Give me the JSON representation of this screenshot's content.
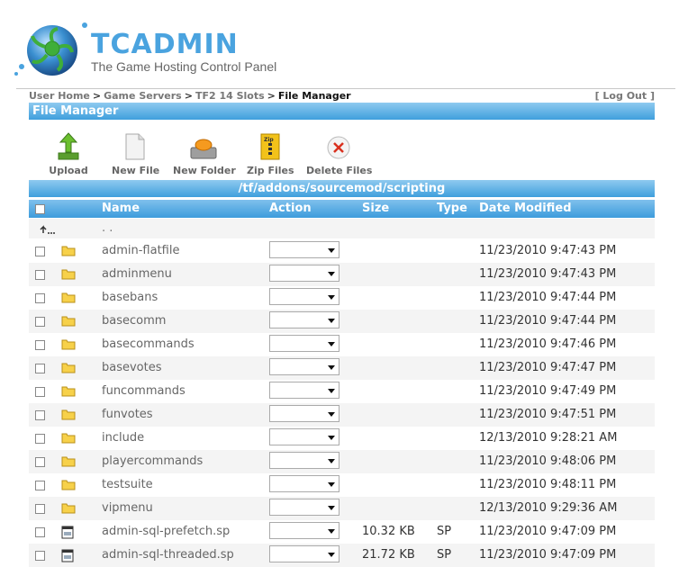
{
  "brand": {
    "name": "TCADMIN",
    "tagline": "The Game Hosting Control Panel"
  },
  "breadcrumb": [
    {
      "label": "User Home",
      "current": false
    },
    {
      "label": "Game Servers",
      "current": false
    },
    {
      "label": "TF2 14 Slots",
      "current": false
    },
    {
      "label": "File Manager",
      "current": true
    }
  ],
  "logout": "[ Log Out ]",
  "page_title": "File Manager",
  "toolbar": [
    {
      "label": "Upload",
      "icon": "upload-icon"
    },
    {
      "label": "New File",
      "icon": "new-file-icon"
    },
    {
      "label": "New Folder",
      "icon": "new-folder-icon"
    },
    {
      "label": "Zip Files",
      "icon": "zip-icon"
    },
    {
      "label": "Delete Files",
      "icon": "delete-icon"
    }
  ],
  "current_path": "/tf/addons/sourcemod/scripting",
  "columns": {
    "name": "Name",
    "action": "Action",
    "size": "Size",
    "type": "Type",
    "date": "Date Modified"
  },
  "parent_dir": ". .",
  "files": [
    {
      "name": "admin-flatfile",
      "kind": "folder",
      "size": "",
      "type": "",
      "date": "11/23/2010 9:47:43 PM"
    },
    {
      "name": "adminmenu",
      "kind": "folder",
      "size": "",
      "type": "",
      "date": "11/23/2010 9:47:43 PM"
    },
    {
      "name": "basebans",
      "kind": "folder",
      "size": "",
      "type": "",
      "date": "11/23/2010 9:47:44 PM"
    },
    {
      "name": "basecomm",
      "kind": "folder",
      "size": "",
      "type": "",
      "date": "11/23/2010 9:47:44 PM"
    },
    {
      "name": "basecommands",
      "kind": "folder",
      "size": "",
      "type": "",
      "date": "11/23/2010 9:47:46 PM"
    },
    {
      "name": "basevotes",
      "kind": "folder",
      "size": "",
      "type": "",
      "date": "11/23/2010 9:47:47 PM"
    },
    {
      "name": "funcommands",
      "kind": "folder",
      "size": "",
      "type": "",
      "date": "11/23/2010 9:47:49 PM"
    },
    {
      "name": "funvotes",
      "kind": "folder",
      "size": "",
      "type": "",
      "date": "11/23/2010 9:47:51 PM"
    },
    {
      "name": "include",
      "kind": "folder",
      "size": "",
      "type": "",
      "date": "12/13/2010 9:28:21 AM"
    },
    {
      "name": "playercommands",
      "kind": "folder",
      "size": "",
      "type": "",
      "date": "11/23/2010 9:48:06 PM"
    },
    {
      "name": "testsuite",
      "kind": "folder",
      "size": "",
      "type": "",
      "date": "11/23/2010 9:48:11 PM"
    },
    {
      "name": "vipmenu",
      "kind": "folder",
      "size": "",
      "type": "",
      "date": "12/13/2010 9:29:36 AM"
    },
    {
      "name": "admin-sql-prefetch.sp",
      "kind": "file",
      "size": "10.32 KB",
      "type": "SP",
      "date": "11/23/2010 9:47:09 PM"
    },
    {
      "name": "admin-sql-threaded.sp",
      "kind": "file",
      "size": "21.72 KB",
      "type": "SP",
      "date": "11/23/2010 9:47:09 PM"
    }
  ],
  "colors": {
    "accent": "#3f9fdd",
    "brand": "#4aa3df",
    "folder": "#f7d14a"
  }
}
